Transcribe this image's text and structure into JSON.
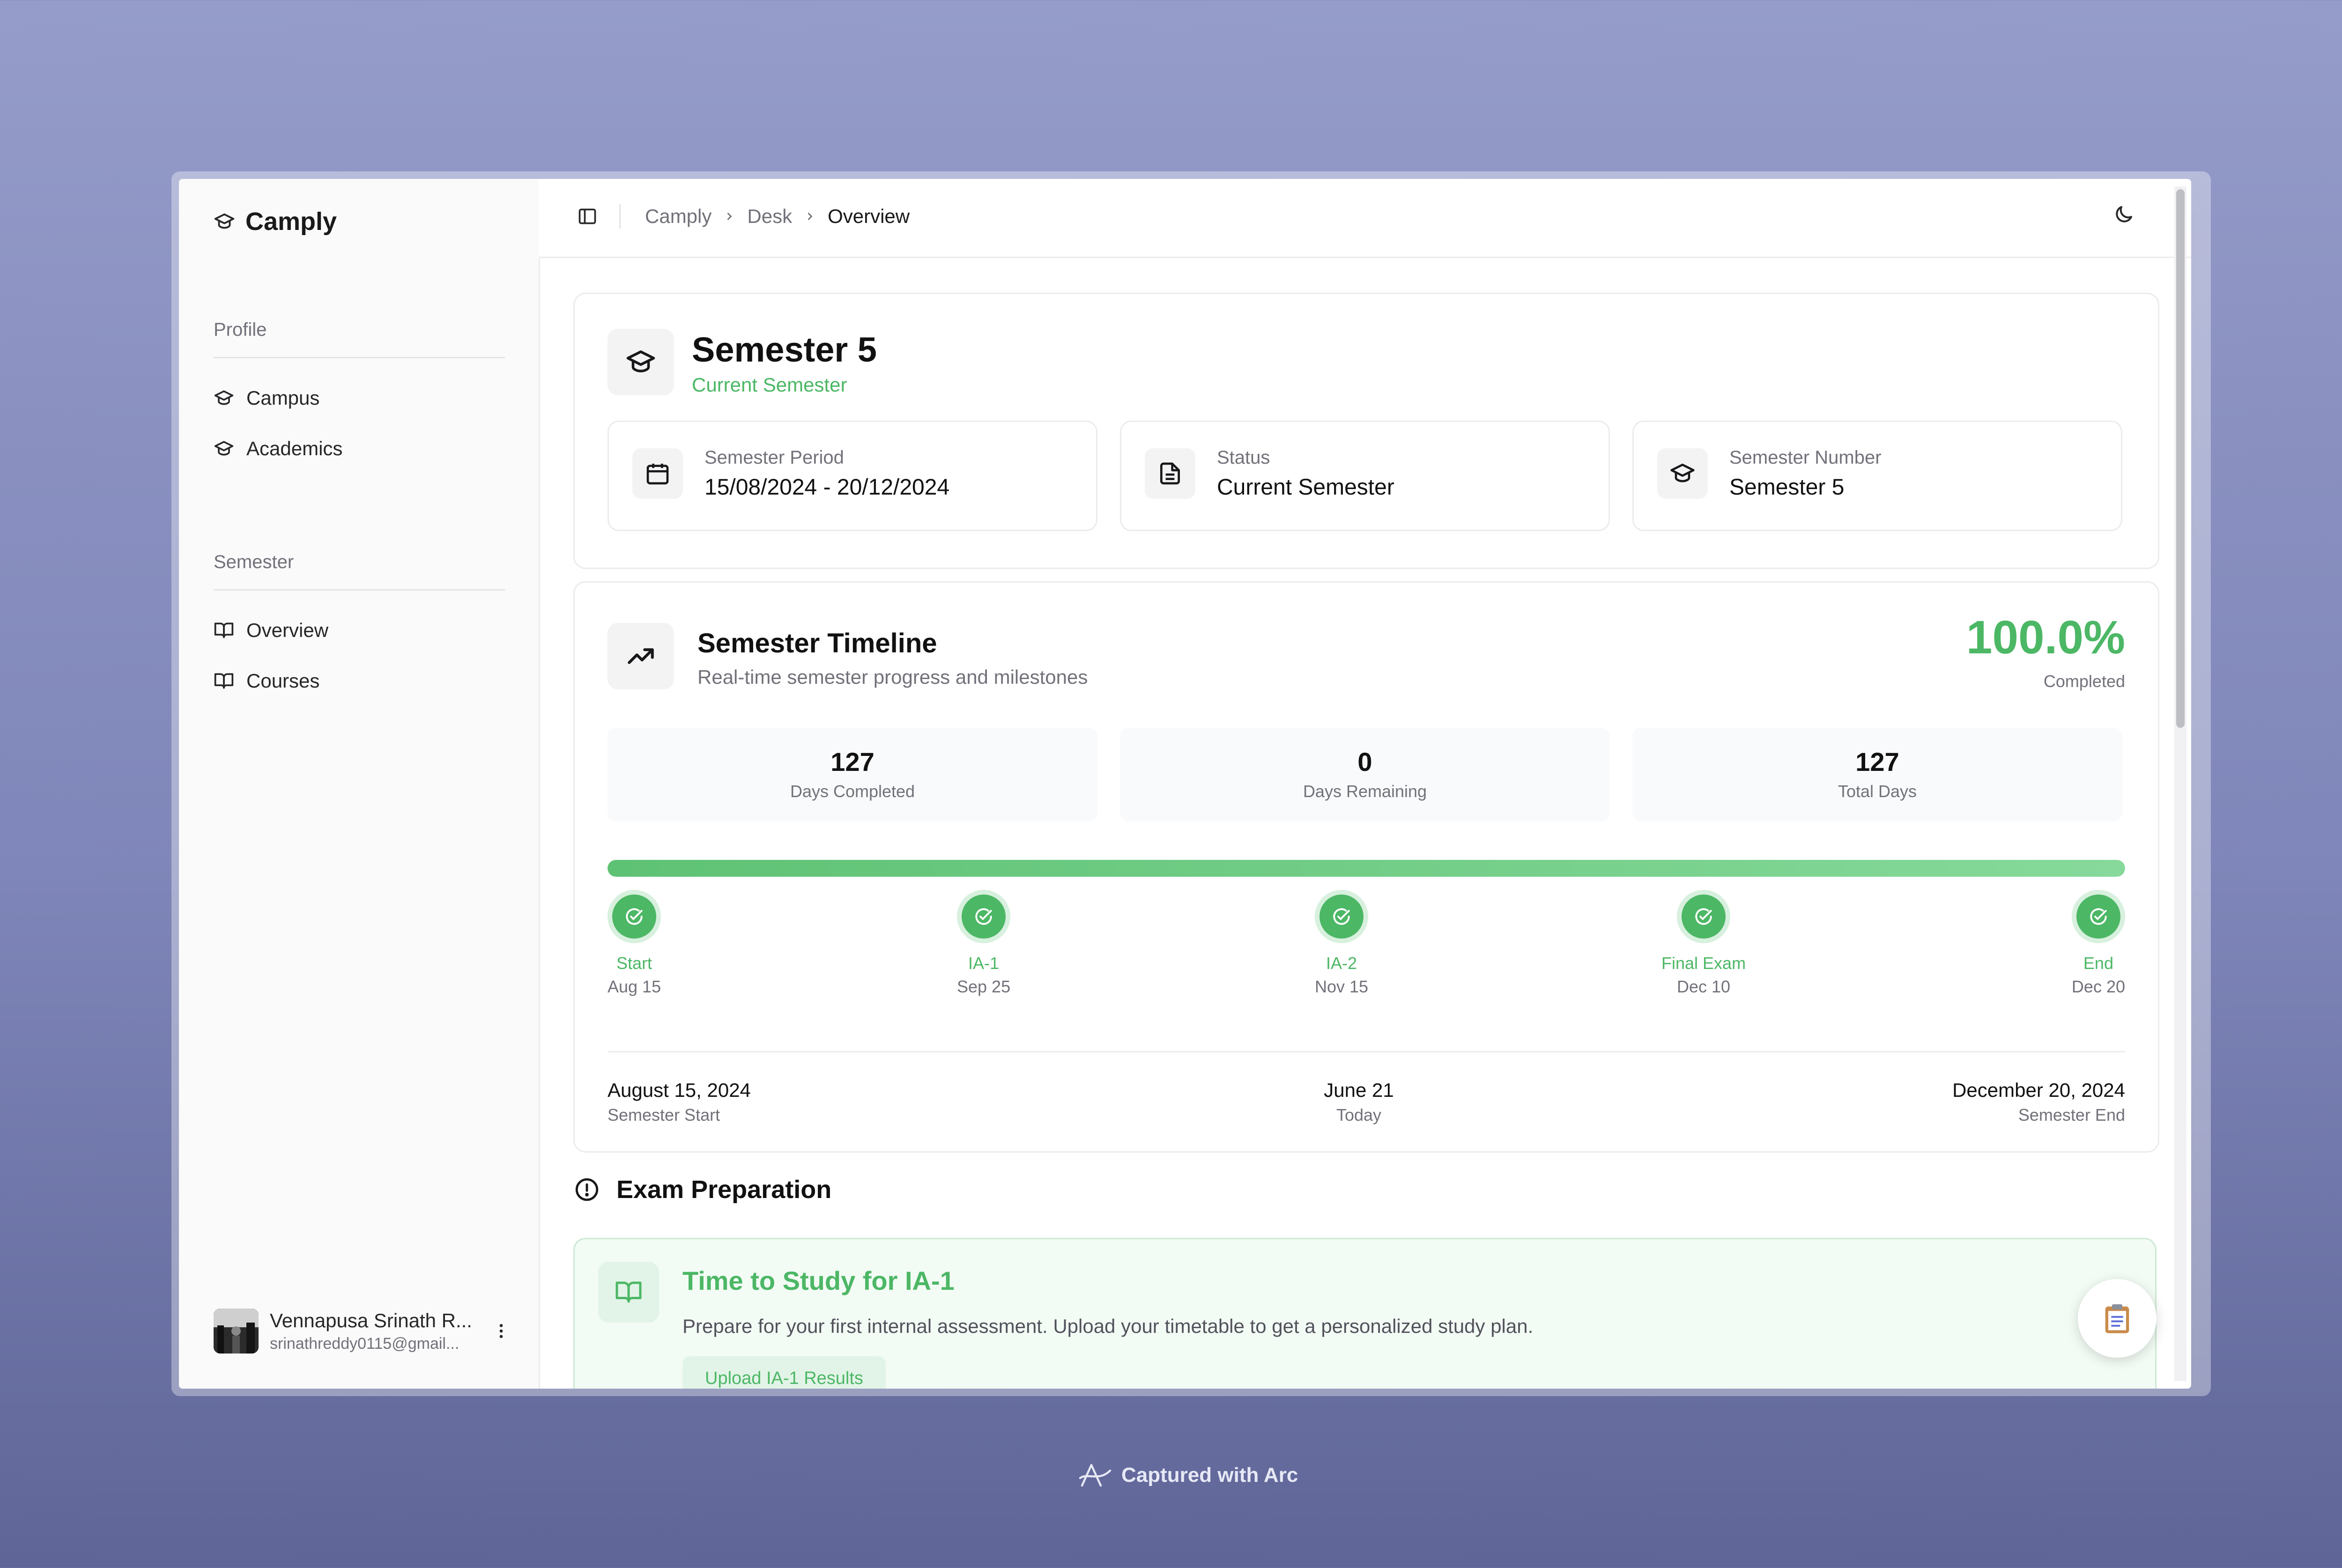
{
  "app": {
    "brand": "Camply"
  },
  "sidebar": {
    "sections": [
      {
        "label": "Profile",
        "items": [
          {
            "label": "Campus",
            "icon": "graduation-cap-icon"
          },
          {
            "label": "Academics",
            "icon": "graduation-cap-icon"
          }
        ]
      },
      {
        "label": "Semester",
        "items": [
          {
            "label": "Overview",
            "icon": "book-open-icon"
          },
          {
            "label": "Courses",
            "icon": "book-open-icon"
          }
        ]
      }
    ],
    "user": {
      "name": "Vennapusa Srinath R...",
      "email": "srinathreddy0115@gmail..."
    }
  },
  "topbar": {
    "breadcrumb": [
      "Camply",
      "Desk",
      "Overview"
    ]
  },
  "semester": {
    "title": "Semester 5",
    "subtitle": "Current Semester",
    "info": [
      {
        "label": "Semester Period",
        "value": "15/08/2024 - 20/12/2024",
        "icon": "calendar-icon"
      },
      {
        "label": "Status",
        "value": "Current Semester",
        "icon": "document-icon"
      },
      {
        "label": "Semester Number",
        "value": "Semester 5",
        "icon": "graduation-cap-icon"
      }
    ]
  },
  "timeline": {
    "title": "Semester Timeline",
    "subtitle": "Real-time semester progress and milestones",
    "percent": "100.0%",
    "percent_label": "Completed",
    "progress_fraction": 1.0,
    "stats": [
      {
        "value": "127",
        "label": "Days Completed"
      },
      {
        "value": "0",
        "label": "Days Remaining"
      },
      {
        "value": "127",
        "label": "Total Days"
      }
    ],
    "milestones": [
      {
        "label": "Start",
        "date": "Aug 15"
      },
      {
        "label": "IA-1",
        "date": "Sep 25"
      },
      {
        "label": "IA-2",
        "date": "Nov 15"
      },
      {
        "label": "Final Exam",
        "date": "Dec 10"
      },
      {
        "label": "End",
        "date": "Dec 20"
      }
    ],
    "dates": {
      "start": {
        "date": "August 15, 2024",
        "label": "Semester Start"
      },
      "today": {
        "date": "June 21",
        "label": "Today"
      },
      "end": {
        "date": "December 20, 2024",
        "label": "Semester End"
      }
    }
  },
  "exam": {
    "heading": "Exam Preparation",
    "card": {
      "title": "Time to Study for IA-1",
      "description": "Prepare for your first internal assessment. Upload your timetable to get a personalized study plan.",
      "button": "Upload IA-1 Results"
    }
  },
  "footer": {
    "credit": "Captured with Arc"
  },
  "colors": {
    "accent_green": "#4cb765",
    "background_top": "#959cc9",
    "background_bottom": "#5f6597"
  }
}
